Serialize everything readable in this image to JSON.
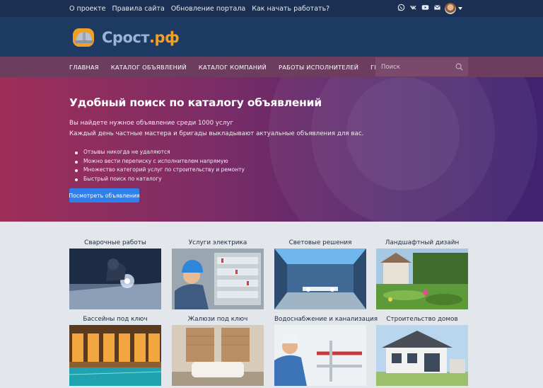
{
  "topbar": {
    "links": [
      "О проекте",
      "Правила сайта",
      "Обновление портала",
      "Как начать работать?"
    ],
    "social_icons": [
      "whatsapp-icon",
      "vk-icon",
      "youtube-icon",
      "mail-icon"
    ]
  },
  "logo": {
    "part1": "Срост",
    "part2": ".рф"
  },
  "nav": {
    "items": [
      "ГЛАВНАЯ",
      "КАТАЛОГ ОБЪЯВЛЕНИЙ",
      "КАТАЛОГ КОМПАНИЙ",
      "РАБОТЫ ИСПОЛНИТЕЛЕЙ",
      "ГРУППЫ"
    ],
    "search_placeholder": "Поиск"
  },
  "hero": {
    "title": "Удобный поиск по каталогу объявлений",
    "line1": "Вы найдете нужное объявление среди 1000 услуг",
    "line2": "Каждый день частные мастера и бригады выкладывают актуальные объявления для вас.",
    "bullets": [
      "Отзывы никогда не удаляются",
      "Можно вести переписку с исполнителем напрямую",
      "Множество категорий услуг по строительству и ремонту",
      "Быстрый поиск по каталогу"
    ],
    "cta_label": "Посмотреть объявления"
  },
  "categories": [
    "Сварочные работы",
    "Услуги электрика",
    "Световые решения",
    "Ландшафтный дизайн",
    "Бассейны под ключ",
    "Жалюзи под ключ",
    "Водоснабжение и канализация",
    "Строительство домов"
  ],
  "colors": {
    "topbar": "#1a2f52",
    "header": "#1d3a63",
    "nav": "#6d3d5f",
    "cta": "#2f80ed",
    "logo_accent": "#f0a024"
  }
}
